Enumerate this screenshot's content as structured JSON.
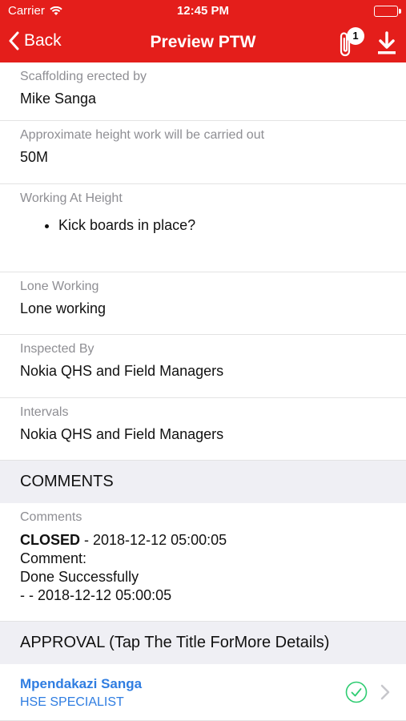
{
  "status_bar": {
    "carrier": "Carrier",
    "time": "12:45 PM"
  },
  "nav": {
    "back_label": "Back",
    "title": "Preview PTW",
    "attachment_count": "1"
  },
  "fields": [
    {
      "label": "Scaffolding erected by",
      "value": "Mike Sanga"
    },
    {
      "label": "Approximate height work will be carried out",
      "value": "50M"
    },
    {
      "label": "Working At Height",
      "items": [
        "Kick boards in place?"
      ]
    },
    {
      "label": "Lone Working",
      "value": "Lone working"
    },
    {
      "label": "Inspected By",
      "value": "Nokia QHS and Field Managers"
    },
    {
      "label": "Intervals",
      "value": "Nokia QHS and Field Managers"
    }
  ],
  "comments_section": {
    "header": "COMMENTS",
    "label": "Comments",
    "status": "CLOSED",
    "status_suffix": " - 2018-12-12 05:00:05",
    "comment_label": "Comment:",
    "comment_text": "Done Successfully",
    "footer": "- - 2018-12-12 05:00:05"
  },
  "approval_section": {
    "header": "APPROVAL (Tap The Title ForMore Details)",
    "approvers": [
      {
        "name": "Mpendakazi Sanga",
        "role": "HSE SPECIALIST",
        "status": "approved"
      }
    ]
  },
  "colors": {
    "brand": "#e41e1b",
    "link": "#2f7de1",
    "success": "#2ecc71"
  },
  "icons": {
    "back": "chevron-left-icon",
    "wifi": "wifi-icon",
    "battery": "battery-icon",
    "attachment": "paperclip-icon",
    "download": "download-icon",
    "approved": "check-circle-icon",
    "disclosure": "chevron-right-icon"
  }
}
